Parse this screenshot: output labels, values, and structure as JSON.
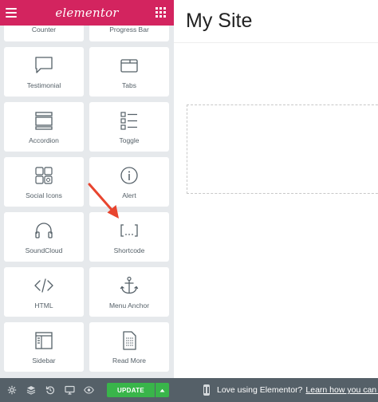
{
  "topbar": {
    "logo": "elementor"
  },
  "widgets": [
    {
      "label": "Counter",
      "icon": "counter-icon"
    },
    {
      "label": "Progress Bar",
      "icon": "progress-bar-icon"
    },
    {
      "label": "Testimonial",
      "icon": "testimonial-icon"
    },
    {
      "label": "Tabs",
      "icon": "tabs-icon"
    },
    {
      "label": "Accordion",
      "icon": "accordion-icon"
    },
    {
      "label": "Toggle",
      "icon": "toggle-icon"
    },
    {
      "label": "Social Icons",
      "icon": "social-icons-icon"
    },
    {
      "label": "Alert",
      "icon": "alert-icon"
    },
    {
      "label": "SoundCloud",
      "icon": "soundcloud-icon"
    },
    {
      "label": "Shortcode",
      "icon": "shortcode-icon"
    },
    {
      "label": "HTML",
      "icon": "html-icon"
    },
    {
      "label": "Menu Anchor",
      "icon": "menu-anchor-icon"
    },
    {
      "label": "Sidebar",
      "icon": "sidebar-icon"
    },
    {
      "label": "Read More",
      "icon": "read-more-icon"
    }
  ],
  "bottombar": {
    "update_label": "UPDATE"
  },
  "preview": {
    "site_title": "My Site"
  },
  "footer": {
    "text": "Love using Elementor?",
    "link": "Learn how you can buil"
  },
  "colors": {
    "brand": "#d3245f",
    "update": "#39b54a",
    "panel_bar": "#556068",
    "annotation_arrow": "#e8452f"
  }
}
